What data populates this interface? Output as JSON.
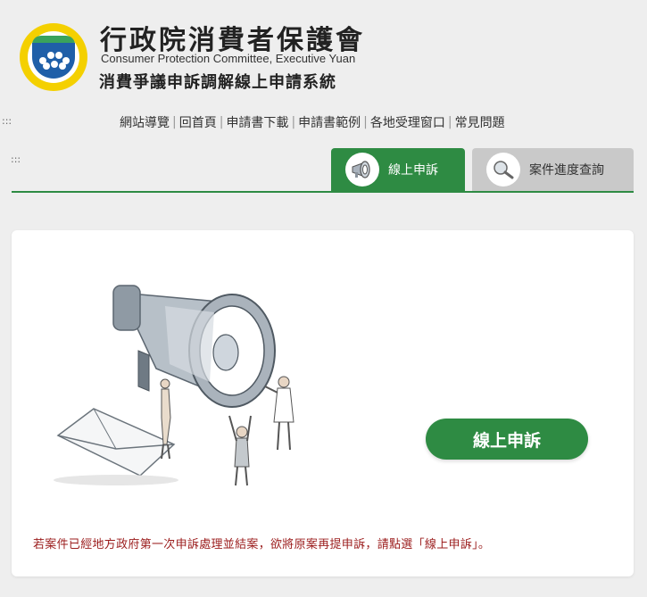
{
  "header": {
    "org_name_zh": "行政院消費者保護會",
    "org_name_en": "Consumer Protection Committee, Executive Yuan",
    "system_name": "消費爭議申訴調解線上申請系統"
  },
  "accesskeys": {
    "top": ":::",
    "mid": ":::"
  },
  "nav": {
    "items": [
      "網站導覽",
      "回首頁",
      "申請書下載",
      "申請書範例",
      "各地受理窗口",
      "常見問題"
    ],
    "separator": "|"
  },
  "tabs": [
    {
      "label": "線上申訴",
      "active": true,
      "icon": "megaphone-icon"
    },
    {
      "label": "案件進度查詢",
      "active": false,
      "icon": "magnifier-icon"
    }
  ],
  "main": {
    "cta_label": "線上申訴",
    "notice": "若案件已經地方政府第一次申訴處理並結案，欲將原案再提申訴，請點選「線上申訴」。"
  },
  "colors": {
    "accent": "#2e8b43",
    "tab_inactive": "#c9c9c9",
    "notice": "#9b1c1c",
    "background": "#eeeeee"
  }
}
